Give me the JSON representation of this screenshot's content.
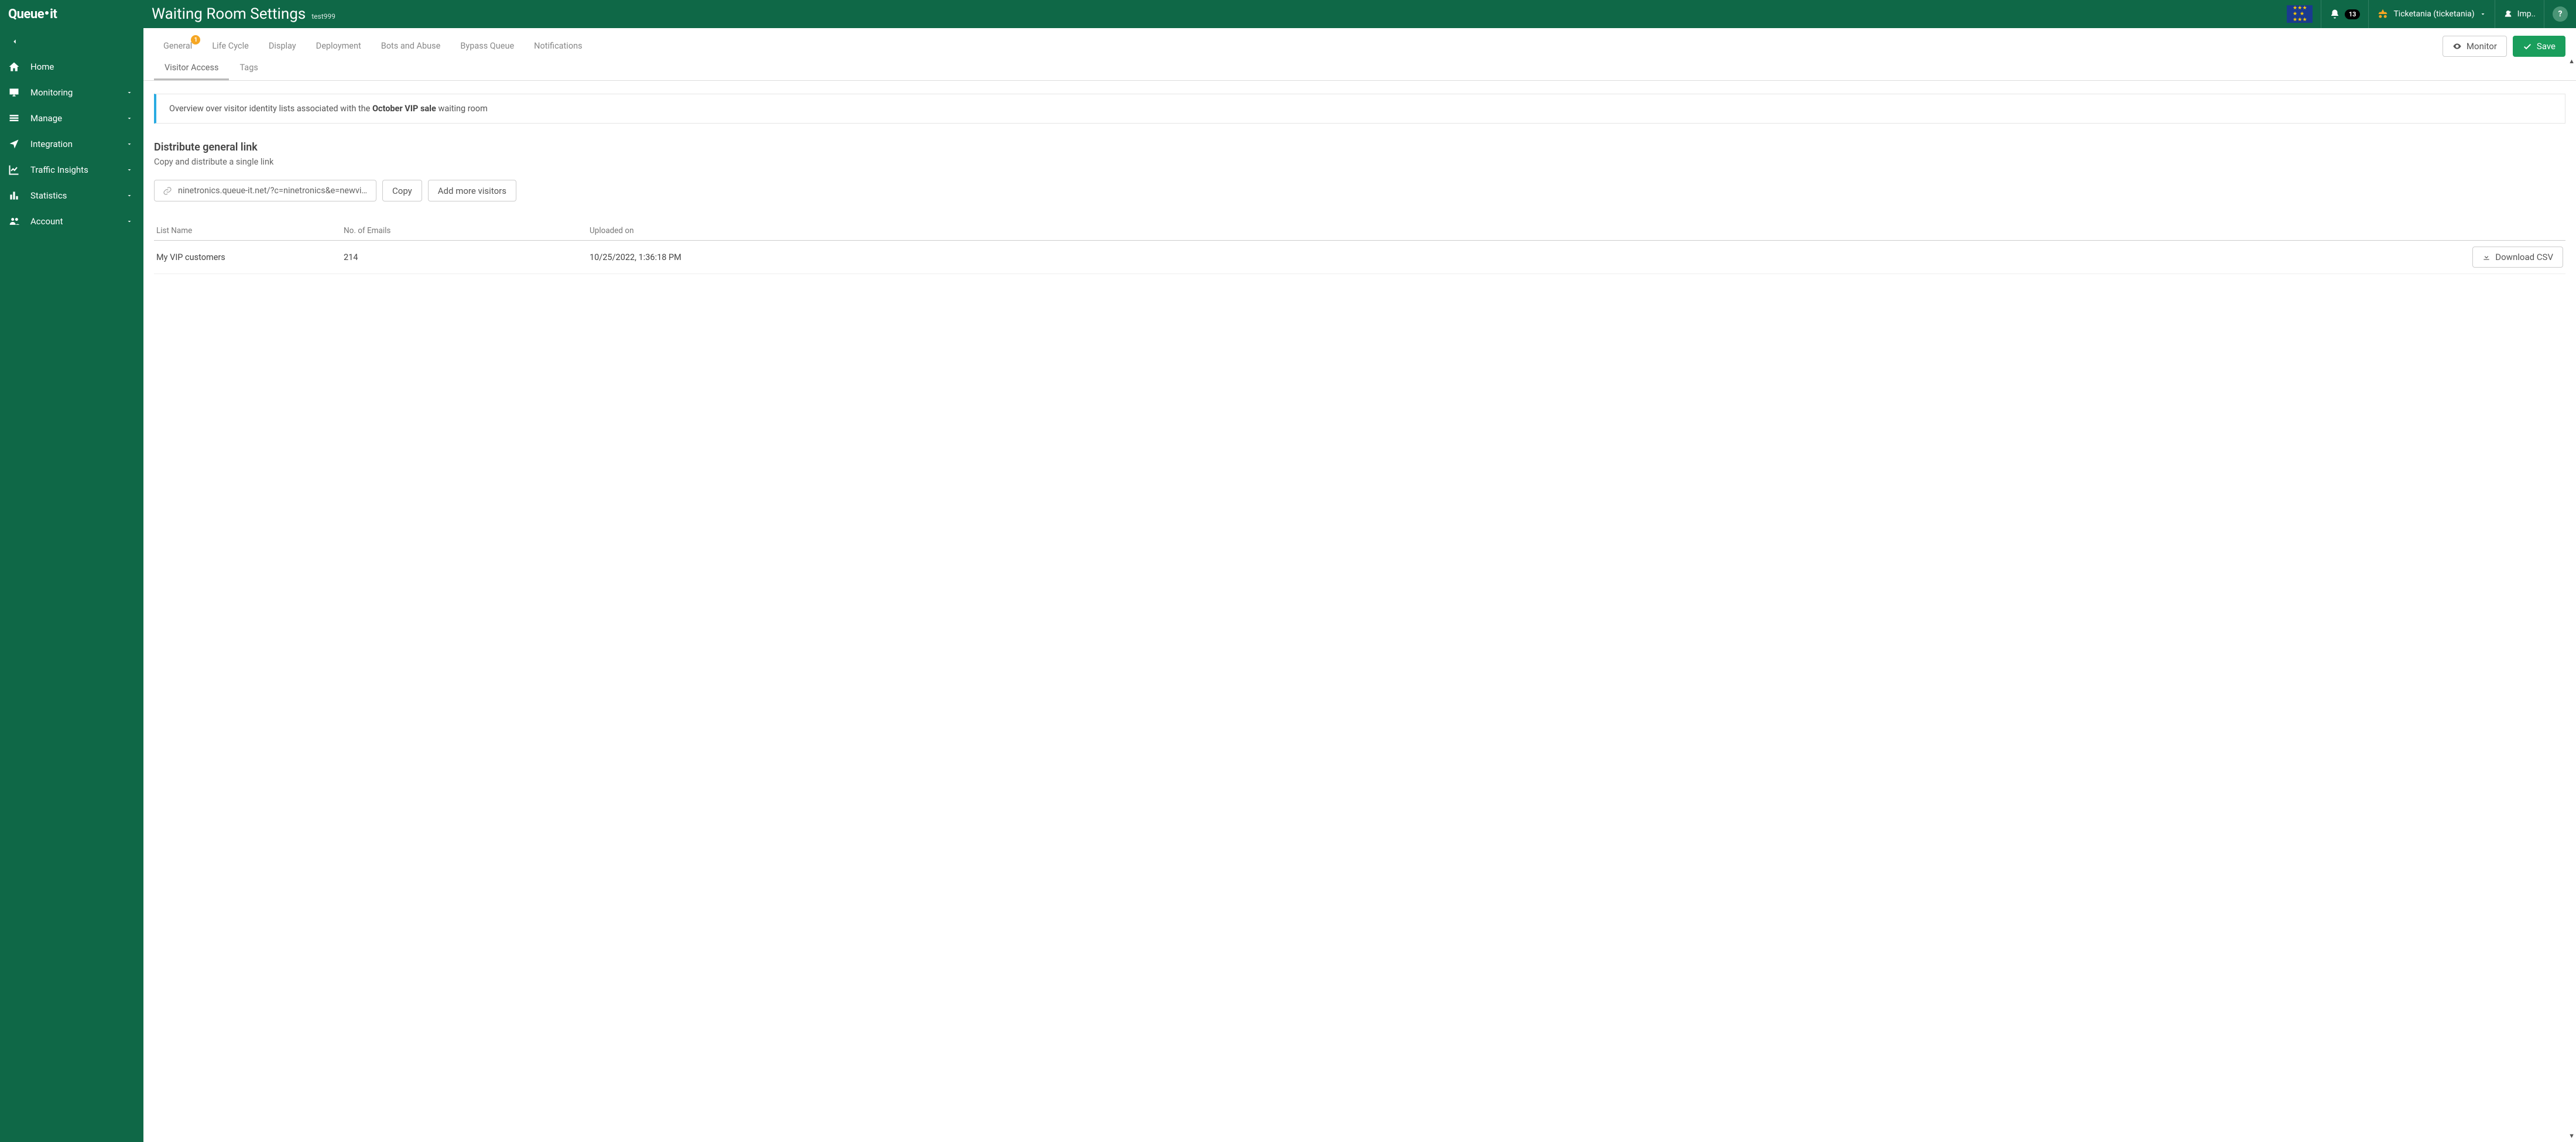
{
  "brand": "Queue·it",
  "header": {
    "title": "Waiting Room Settings",
    "subtitle": "test999",
    "notification_count": "13",
    "account_label": "Ticketania (ticketania)",
    "impersonate_label": "Imp..",
    "help_label": "?"
  },
  "sidebar": {
    "items": [
      {
        "label": "Home",
        "icon": "home",
        "expandable": false
      },
      {
        "label": "Monitoring",
        "icon": "desktop",
        "expandable": true
      },
      {
        "label": "Manage",
        "icon": "list",
        "expandable": true
      },
      {
        "label": "Integration",
        "icon": "location-arrow",
        "expandable": true
      },
      {
        "label": "Traffic Insights",
        "icon": "chart-line",
        "expandable": true
      },
      {
        "label": "Statistics",
        "icon": "chart-bar",
        "expandable": true
      },
      {
        "label": "Account",
        "icon": "users",
        "expandable": true
      }
    ]
  },
  "tabs": {
    "primary": [
      {
        "label": "General",
        "badge": "1"
      },
      {
        "label": "Life Cycle"
      },
      {
        "label": "Display"
      },
      {
        "label": "Deployment"
      },
      {
        "label": "Bots and Abuse"
      },
      {
        "label": "Bypass Queue"
      },
      {
        "label": "Notifications"
      }
    ],
    "secondary": [
      {
        "label": "Visitor Access",
        "active": true
      },
      {
        "label": "Tags",
        "active": false
      }
    ]
  },
  "actions": {
    "monitor": "Monitor",
    "save": "Save"
  },
  "banner": {
    "prefix": "Overview over visitor identity lists associated with the ",
    "bold": "October VIP sale",
    "suffix": " waiting room"
  },
  "distribute": {
    "title": "Distribute general link",
    "desc": "Copy and distribute a single link",
    "link_value": "ninetronics.queue-it.net/?c=ninetronics&e=newvipeve...",
    "copy_label": "Copy",
    "add_label": "Add more visitors"
  },
  "table": {
    "headers": {
      "name": "List Name",
      "emails": "No. of Emails",
      "uploaded": "Uploaded on"
    },
    "rows": [
      {
        "name": "My VIP customers",
        "emails": "214",
        "uploaded": "10/25/2022, 1:36:18 PM"
      }
    ],
    "download_label": "Download CSV"
  }
}
